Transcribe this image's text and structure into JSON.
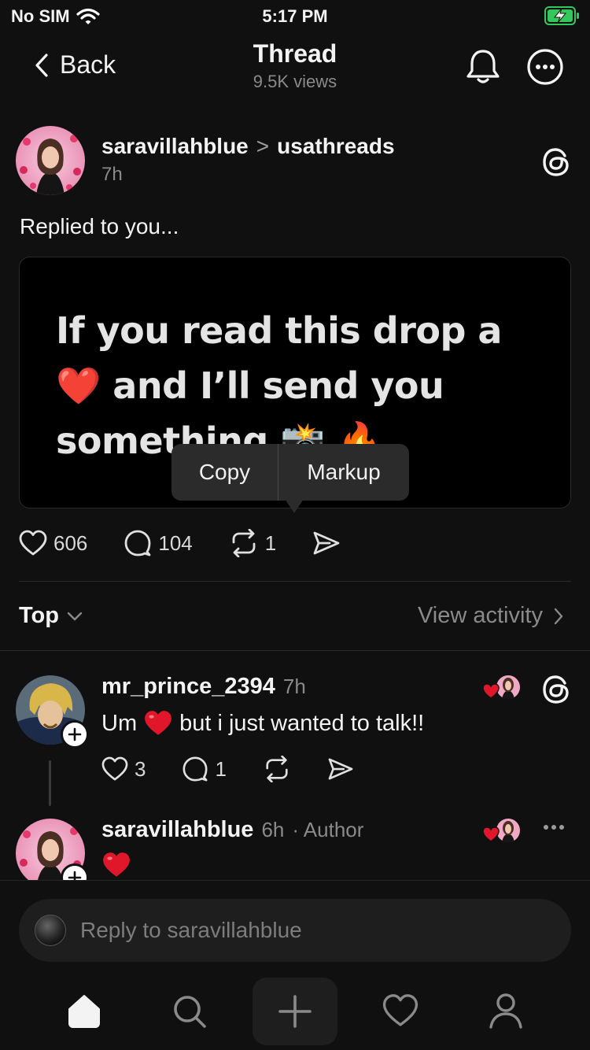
{
  "status_bar": {
    "carrier": "No SIM",
    "time": "5:17 PM"
  },
  "header": {
    "back_label": "Back",
    "title": "Thread",
    "views": "9.5K views"
  },
  "post": {
    "username": "saravillahblue",
    "separator": ">",
    "reply_to": "usathreads",
    "time": "7h",
    "text": "Replied to you...",
    "image_text": "If you read this drop a ❤️ and I’ll send you something 📸 🔥",
    "likes": "606",
    "comments": "104",
    "reposts": "1"
  },
  "context_menu": {
    "items": [
      "Copy",
      "Markup"
    ]
  },
  "sort": {
    "label": "Top",
    "view_activity": "View activity"
  },
  "replies": [
    {
      "username": "mr_prince_2394",
      "time": "7h",
      "author": "",
      "text_before": "Um",
      "emoji": "❤️",
      "text_after": "but i just wanted to talk!!",
      "likes": "3",
      "comments": "1"
    },
    {
      "username": "saravillahblue",
      "time": "6h",
      "author": "· Author",
      "text_before": "",
      "emoji": "❤️",
      "text_after": ""
    }
  ],
  "composer": {
    "placeholder": "Reply to saravillahblue"
  },
  "colors": {
    "background": "#101010",
    "heart": "#e0162b",
    "battery_green": "#34c759"
  }
}
